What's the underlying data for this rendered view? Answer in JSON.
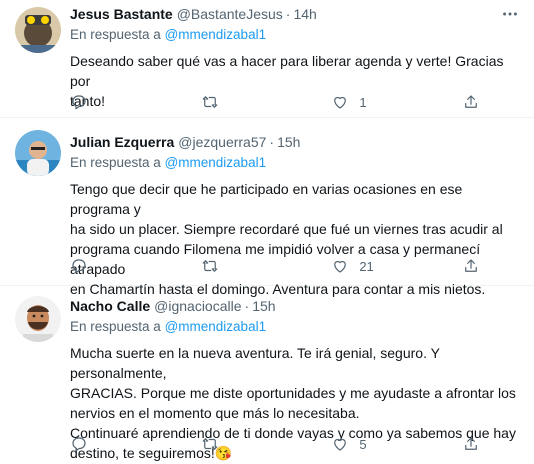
{
  "tweets": [
    {
      "name": "Jesus Bastante",
      "handle": "@BastanteJesus",
      "time": "14h",
      "reply_prefix": "En respuesta a",
      "reply_to": "@mmendizabal1",
      "text": "Deseando saber qué vas a hacer para liberar agenda y verte! Gracias por\ntanto!",
      "replies": "",
      "retweets": "",
      "likes": "1"
    },
    {
      "name": "Julian Ezquerra",
      "handle": "@jezquerra57",
      "time": "15h",
      "reply_prefix": "En respuesta a",
      "reply_to": "@mmendizabal1",
      "text": "Tengo que decir que he participado en varias ocasiones en ese programa y\nha sido un placer. Siempre recordaré que fué un viernes tras acudir al\nprograma cuando Filomena me impidió volver a casa y permanecí atrapado\nen Chamartín hasta el domingo. Aventura para contar a mis nietos.",
      "replies": "",
      "retweets": "",
      "likes": "21"
    },
    {
      "name": "Nacho Calle",
      "handle": "@ignaciocalle",
      "time": "15h",
      "reply_prefix": "En respuesta a",
      "reply_to": "@mmendizabal1",
      "text": "Mucha suerte en la nueva aventura. Te irá genial, seguro. Y personalmente,\nGRACIAS. Porque me diste oportunidades y me ayudaste a afrontar los\nnervios en el momento que más lo necesitaba.\nContinuaré aprendiendo de ti donde vayas y como ya sabemos que hay\ndestino, te seguiremos!😘",
      "replies": "",
      "retweets": "",
      "likes": "5"
    }
  ],
  "separator": "·",
  "icons": {
    "more": "more-dots-icon",
    "reply": "reply-icon",
    "retweet": "retweet-icon",
    "like": "heart-icon",
    "share": "share-icon"
  },
  "colors": {
    "accent": "#1d9bf0",
    "secondary_text": "#536471",
    "primary_text": "#0f1419",
    "divider": "#eff3f4"
  }
}
